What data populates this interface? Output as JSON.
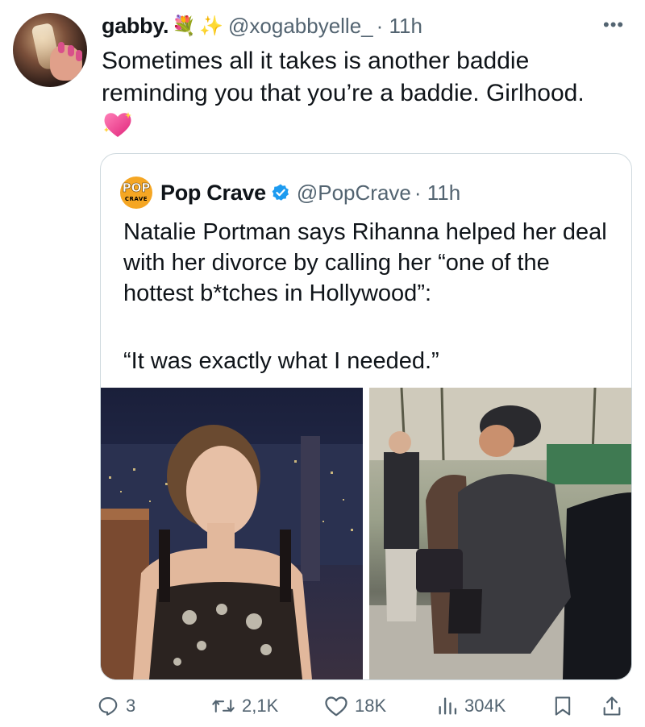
{
  "author": {
    "name": "gabby.",
    "emojis": [
      "💐",
      "✨"
    ],
    "handle": "@xogabbyelle_",
    "time": "· 11h"
  },
  "tweet": {
    "text": "Sometimes all it takes is another baddie reminding you that you’re a baddie. Girlhood.",
    "emoji": "💖"
  },
  "quote": {
    "logo_top": "POP",
    "logo_bottom": "CRAVE",
    "name": "Pop Crave",
    "handle": "@PopCrave",
    "time": "· 11h",
    "text": "Natalie Portman says Rihanna helped her deal with her divorce by calling her “one of the hottest b*tches in Hollywood”:",
    "quote_text": "“It was exactly what I needed.”"
  },
  "actions": {
    "replies": "3",
    "reposts": "2,1K",
    "likes": "18K",
    "views": "304K"
  },
  "colors": {
    "text": "#0f1419",
    "secondary": "#536471",
    "verified": "#1d9bf0",
    "border": "#cfd9de"
  }
}
